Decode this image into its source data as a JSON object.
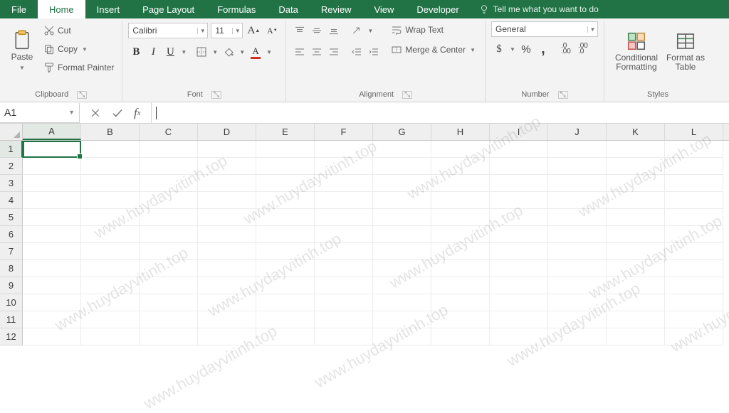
{
  "tabs": {
    "file": "File",
    "home": "Home",
    "insert": "Insert",
    "pagelayout": "Page Layout",
    "formulas": "Formulas",
    "data": "Data",
    "review": "Review",
    "view": "View",
    "developer": "Developer",
    "tellme": "Tell me what you want to do"
  },
  "ribbon": {
    "clipboard": {
      "paste": "Paste",
      "cut": "Cut",
      "copy": "Copy",
      "format_painter": "Format Painter",
      "label": "Clipboard"
    },
    "font": {
      "name": "Calibri",
      "size": "11",
      "label": "Font"
    },
    "alignment": {
      "wrap": "Wrap Text",
      "merge": "Merge & Center",
      "label": "Alignment"
    },
    "number": {
      "format": "General",
      "label": "Number"
    },
    "styles": {
      "cond": "Conditional Formatting",
      "fmt_table": "Format as Table",
      "label": "Styles"
    }
  },
  "formula_bar": {
    "namebox": "A1",
    "formula": ""
  },
  "grid": {
    "columns": [
      "A",
      "B",
      "C",
      "D",
      "E",
      "F",
      "G",
      "H",
      "I",
      "J",
      "K",
      "L"
    ],
    "rows": [
      "1",
      "2",
      "3",
      "4",
      "5",
      "6",
      "7",
      "8",
      "9",
      "10",
      "11",
      "12"
    ],
    "active_cell": "A1"
  },
  "watermark": "www.huydayvitinh.top"
}
